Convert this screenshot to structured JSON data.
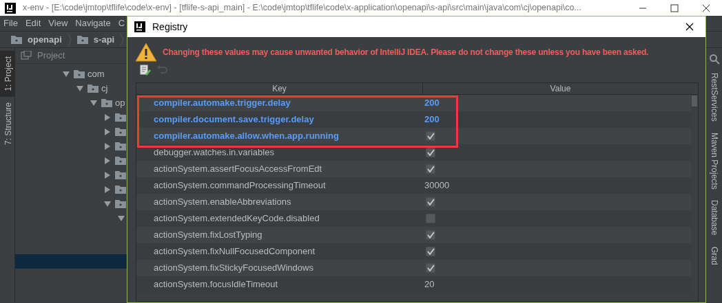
{
  "window": {
    "title": "x-env - [E:\\code\\jmtop\\tflife\\code\\x-env] - [tflife-s-api_main] - E:\\code\\jmtop\\tflife\\code\\x-application\\openapi\\s-api\\src\\main\\java\\com\\cj\\openapi\\co..."
  },
  "menu": [
    "File",
    "Edit",
    "View",
    "Navigate",
    "C"
  ],
  "breadcrumb": [
    "openapi",
    "s-api"
  ],
  "left_toolbar": [
    {
      "label": "1: Project",
      "selected": true
    },
    {
      "label": "7: Structure",
      "selected": false
    }
  ],
  "project_panel": {
    "title": "Project",
    "tree": [
      {
        "label": "com",
        "expanded": true,
        "selected": false,
        "children": [
          {
            "label": "cj",
            "expanded": true,
            "selected": false,
            "children": [
              {
                "label": "op",
                "expanded": true,
                "selected": false,
                "children": [
                  {
                    "expanded": false,
                    "selected": false
                  },
                  {
                    "expanded": false,
                    "selected": false
                  },
                  {
                    "expanded": false,
                    "selected": false
                  },
                  {
                    "expanded": false,
                    "selected": false
                  },
                  {
                    "expanded": false,
                    "selected": false
                  },
                  {
                    "expanded": false,
                    "selected": false
                  },
                  {
                    "expanded": true,
                    "selected": false,
                    "children": [
                      {
                        "expanded": true,
                        "selected": false,
                        "children": [
                          {
                            "selected": false
                          },
                          {
                            "selected": false
                          },
                          {
                            "selected": true
                          }
                        ]
                      }
                    ]
                  }
                ]
              }
            ]
          }
        ]
      }
    ]
  },
  "right_toolbar": [
    "RestServices",
    "Maven Projects",
    "Database",
    "Grad"
  ],
  "dialog": {
    "title": "Registry",
    "warning": "Changing these values may cause unwanted behavior of IntelliJ IDEA. Please do not change these unless you have been asked.",
    "tools": [
      {
        "kind": "edit",
        "disabled": false
      },
      {
        "kind": "revert",
        "disabled": true
      }
    ],
    "columns": [
      "Key",
      "Value"
    ],
    "rows": [
      {
        "key": "compiler.automake.trigger.delay",
        "kind": "text",
        "value": "200",
        "modified": true,
        "framed": true
      },
      {
        "key": "compiler.document.save.trigger.delay",
        "kind": "text",
        "value": "200",
        "modified": true,
        "framed": true
      },
      {
        "key": "compiler.automake.allow.when.app.running",
        "kind": "checkbox",
        "checked": true,
        "modified": true,
        "framed": true
      },
      {
        "key": "debugger.watches.in.variables",
        "kind": "checkbox",
        "checked": true,
        "modified": false,
        "framed": false
      },
      {
        "key": "actionSystem.assertFocusAccessFromEdt",
        "kind": "checkbox",
        "checked": true,
        "modified": false,
        "framed": false
      },
      {
        "key": "actionSystem.commandProcessingTimeout",
        "kind": "text",
        "value": "30000",
        "modified": false,
        "framed": false
      },
      {
        "key": "actionSystem.enableAbbreviations",
        "kind": "checkbox",
        "checked": true,
        "modified": false,
        "framed": false
      },
      {
        "key": "actionSystem.extendedKeyCode.disabled",
        "kind": "checkbox",
        "checked": false,
        "modified": false,
        "framed": false
      },
      {
        "key": "actionSystem.fixLostTyping",
        "kind": "checkbox",
        "checked": true,
        "modified": false,
        "framed": false
      },
      {
        "key": "actionSystem.fixNullFocusedComponent",
        "kind": "checkbox",
        "checked": true,
        "modified": false,
        "framed": false
      },
      {
        "key": "actionSystem.fixStickyFocusedWindows",
        "kind": "checkbox",
        "checked": true,
        "modified": false,
        "framed": false
      },
      {
        "key": "actionSystem.focusIdleTimeout",
        "kind": "text",
        "value": "20",
        "modified": false,
        "framed": false
      }
    ]
  }
}
